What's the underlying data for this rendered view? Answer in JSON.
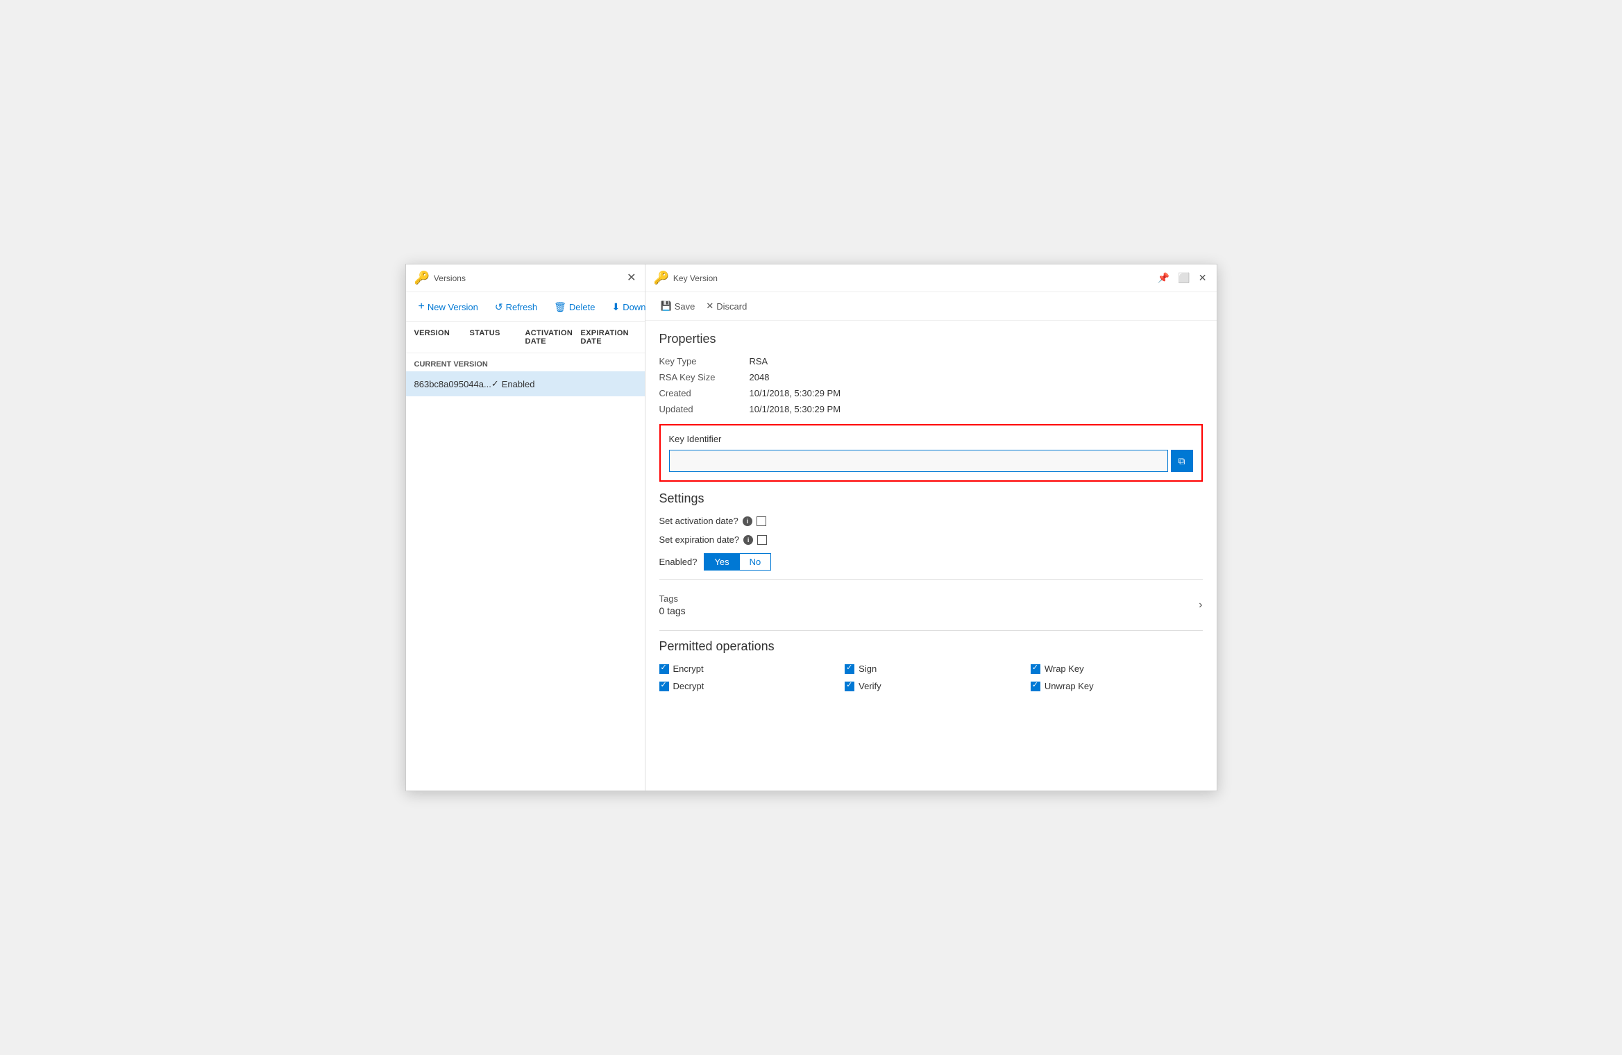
{
  "left_panel": {
    "title": "Versions",
    "toolbar": {
      "new_version": "New Version",
      "refresh": "Refresh",
      "delete": "Delete",
      "download_backup": "Download Backup"
    },
    "table": {
      "columns": [
        "VERSION",
        "STATUS",
        "ACTIVATION DATE",
        "EXPIRATION DATE"
      ],
      "section_label": "CURRENT VERSION",
      "rows": [
        {
          "version": "863bc8a095044a...",
          "status": "Enabled",
          "activation_date": "",
          "expiration_date": ""
        }
      ]
    }
  },
  "right_panel": {
    "title": "Key Version",
    "toolbar": {
      "save": "Save",
      "discard": "Discard"
    },
    "properties": {
      "title": "Properties",
      "key_type_label": "Key Type",
      "key_type_value": "RSA",
      "rsa_key_size_label": "RSA Key Size",
      "rsa_key_size_value": "2048",
      "created_label": "Created",
      "created_value": "10/1/2018, 5:30:29 PM",
      "updated_label": "Updated",
      "updated_value": "10/1/2018, 5:30:29 PM",
      "key_identifier_label": "Key Identifier",
      "key_identifier_value": ""
    },
    "settings": {
      "title": "Settings",
      "activation_date_label": "Set activation date?",
      "expiration_date_label": "Set expiration date?",
      "enabled_label": "Enabled?",
      "yes_label": "Yes",
      "no_label": "No"
    },
    "tags": {
      "title": "Tags",
      "count": "0 tags"
    },
    "permitted_operations": {
      "title": "Permitted operations",
      "operations": [
        {
          "label": "Encrypt",
          "checked": true,
          "row": 0,
          "col": 0
        },
        {
          "label": "Sign",
          "checked": true,
          "row": 0,
          "col": 1
        },
        {
          "label": "Wrap Key",
          "checked": true,
          "row": 0,
          "col": 2
        },
        {
          "label": "Decrypt",
          "checked": true,
          "row": 1,
          "col": 0
        },
        {
          "label": "Verify",
          "checked": true,
          "row": 1,
          "col": 1
        },
        {
          "label": "Unwrap Key",
          "checked": true,
          "row": 1,
          "col": 2
        }
      ]
    }
  }
}
